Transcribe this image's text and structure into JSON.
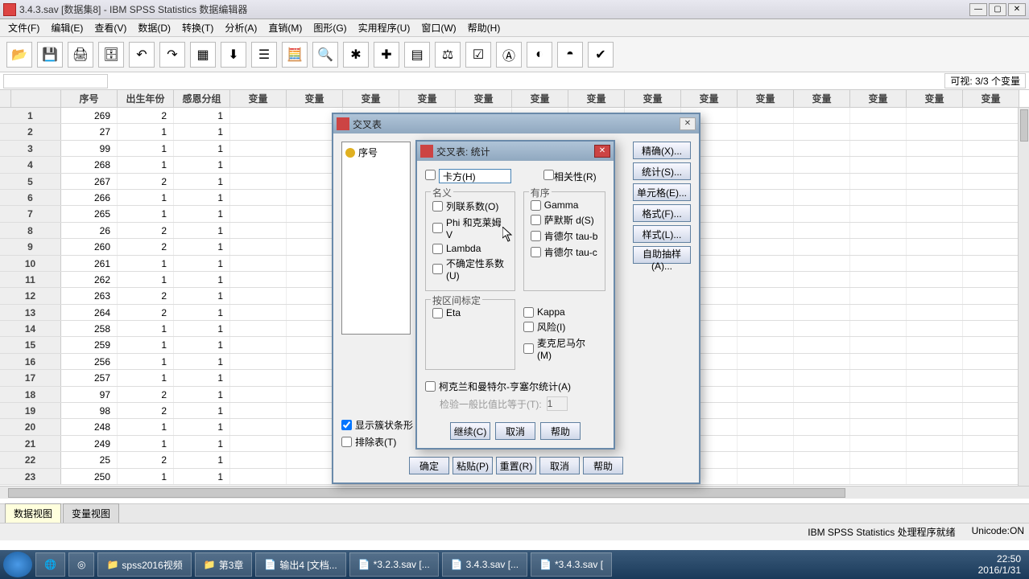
{
  "window": {
    "title": "3.4.3.sav [数据集8] - IBM SPSS Statistics 数据编辑器"
  },
  "visible_status": "可视: 3/3 个变量",
  "menu": [
    "文件(F)",
    "编辑(E)",
    "查看(V)",
    "数据(D)",
    "转换(T)",
    "分析(A)",
    "直销(M)",
    "图形(G)",
    "实用程序(U)",
    "窗口(W)",
    "帮助(H)"
  ],
  "columns": [
    "序号",
    "出生年份",
    "感恩分组",
    "变量",
    "变量",
    "变量",
    "变量",
    "变量",
    "变量",
    "变量",
    "变量",
    "变量",
    "变量",
    "变量",
    "变量",
    "变量",
    "变量"
  ],
  "rows": [
    {
      "n": 1,
      "c": [
        269,
        2,
        1
      ]
    },
    {
      "n": 2,
      "c": [
        27,
        1,
        1
      ]
    },
    {
      "n": 3,
      "c": [
        99,
        1,
        1
      ]
    },
    {
      "n": 4,
      "c": [
        268,
        1,
        1
      ]
    },
    {
      "n": 5,
      "c": [
        267,
        2,
        1
      ]
    },
    {
      "n": 6,
      "c": [
        266,
        1,
        1
      ]
    },
    {
      "n": 7,
      "c": [
        265,
        1,
        1
      ]
    },
    {
      "n": 8,
      "c": [
        26,
        2,
        1
      ]
    },
    {
      "n": 9,
      "c": [
        260,
        2,
        1
      ]
    },
    {
      "n": 10,
      "c": [
        261,
        1,
        1
      ]
    },
    {
      "n": 11,
      "c": [
        262,
        1,
        1
      ]
    },
    {
      "n": 12,
      "c": [
        263,
        2,
        1
      ]
    },
    {
      "n": 13,
      "c": [
        264,
        2,
        1
      ]
    },
    {
      "n": 14,
      "c": [
        258,
        1,
        1
      ]
    },
    {
      "n": 15,
      "c": [
        259,
        1,
        1
      ]
    },
    {
      "n": 16,
      "c": [
        256,
        1,
        1
      ]
    },
    {
      "n": 17,
      "c": [
        257,
        1,
        1
      ]
    },
    {
      "n": 18,
      "c": [
        97,
        2,
        1
      ]
    },
    {
      "n": 19,
      "c": [
        98,
        2,
        1
      ]
    },
    {
      "n": 20,
      "c": [
        248,
        1,
        1
      ]
    },
    {
      "n": 21,
      "c": [
        249,
        1,
        1
      ]
    },
    {
      "n": 22,
      "c": [
        25,
        2,
        1
      ]
    },
    {
      "n": 23,
      "c": [
        250,
        1,
        1
      ]
    }
  ],
  "view_tabs": {
    "data": "数据视图",
    "var": "变量视图"
  },
  "status": {
    "processor": "IBM SPSS Statistics 处理程序就绪",
    "unicode": "Unicode:ON"
  },
  "taskbar": {
    "items": [
      "spss2016视频",
      "第3章",
      "输出4 [文档...",
      "*3.2.3.sav [...",
      "3.4.3.sav [...",
      "*3.4.3.sav ["
    ],
    "clock": {
      "time": "22:50",
      "date": "2016/1/31"
    }
  },
  "crosstab": {
    "title": "交叉表",
    "var": "序号",
    "show_bar": "显示簇状条形",
    "suppress": "排除表(T)",
    "btns": {
      "ok": "确定",
      "paste": "粘贴(P)",
      "reset": "重置(R)",
      "cancel": "取消",
      "help": "帮助"
    },
    "side": {
      "exact": "精确(X)...",
      "stats": "统计(S)...",
      "cells": "单元格(E)...",
      "format": "格式(F)...",
      "style": "样式(L)...",
      "bootstrap": "自助抽样(A)..."
    }
  },
  "stats": {
    "title": "交叉表: 统计",
    "chi": "卡方(H)",
    "corr": "相关性(R)",
    "nominal_title": "名义",
    "nominal": {
      "cc": "列联系数(O)",
      "phi": "Phi 和克莱姆 V",
      "lambda": "Lambda",
      "uc": "不确定性系数(U)"
    },
    "ordinal_title": "有序",
    "ordinal": {
      "gamma": "Gamma",
      "somers": "萨默斯 d(S)",
      "taub": "肯德尔 tau-b",
      "tauc": "肯德尔 tau-c"
    },
    "interval_title": "按区间标定",
    "eta": "Eta",
    "kappa": "Kappa",
    "risk": "风险(I)",
    "mcnemar": "麦克尼马尔(M)",
    "cmh": "柯克兰和曼特尔-亨塞尔统计(A)",
    "cmh_sub": "检验一般比值比等于(T):",
    "cmh_val": "1",
    "btns": {
      "cont": "继续(C)",
      "cancel": "取消",
      "help": "帮助"
    }
  }
}
